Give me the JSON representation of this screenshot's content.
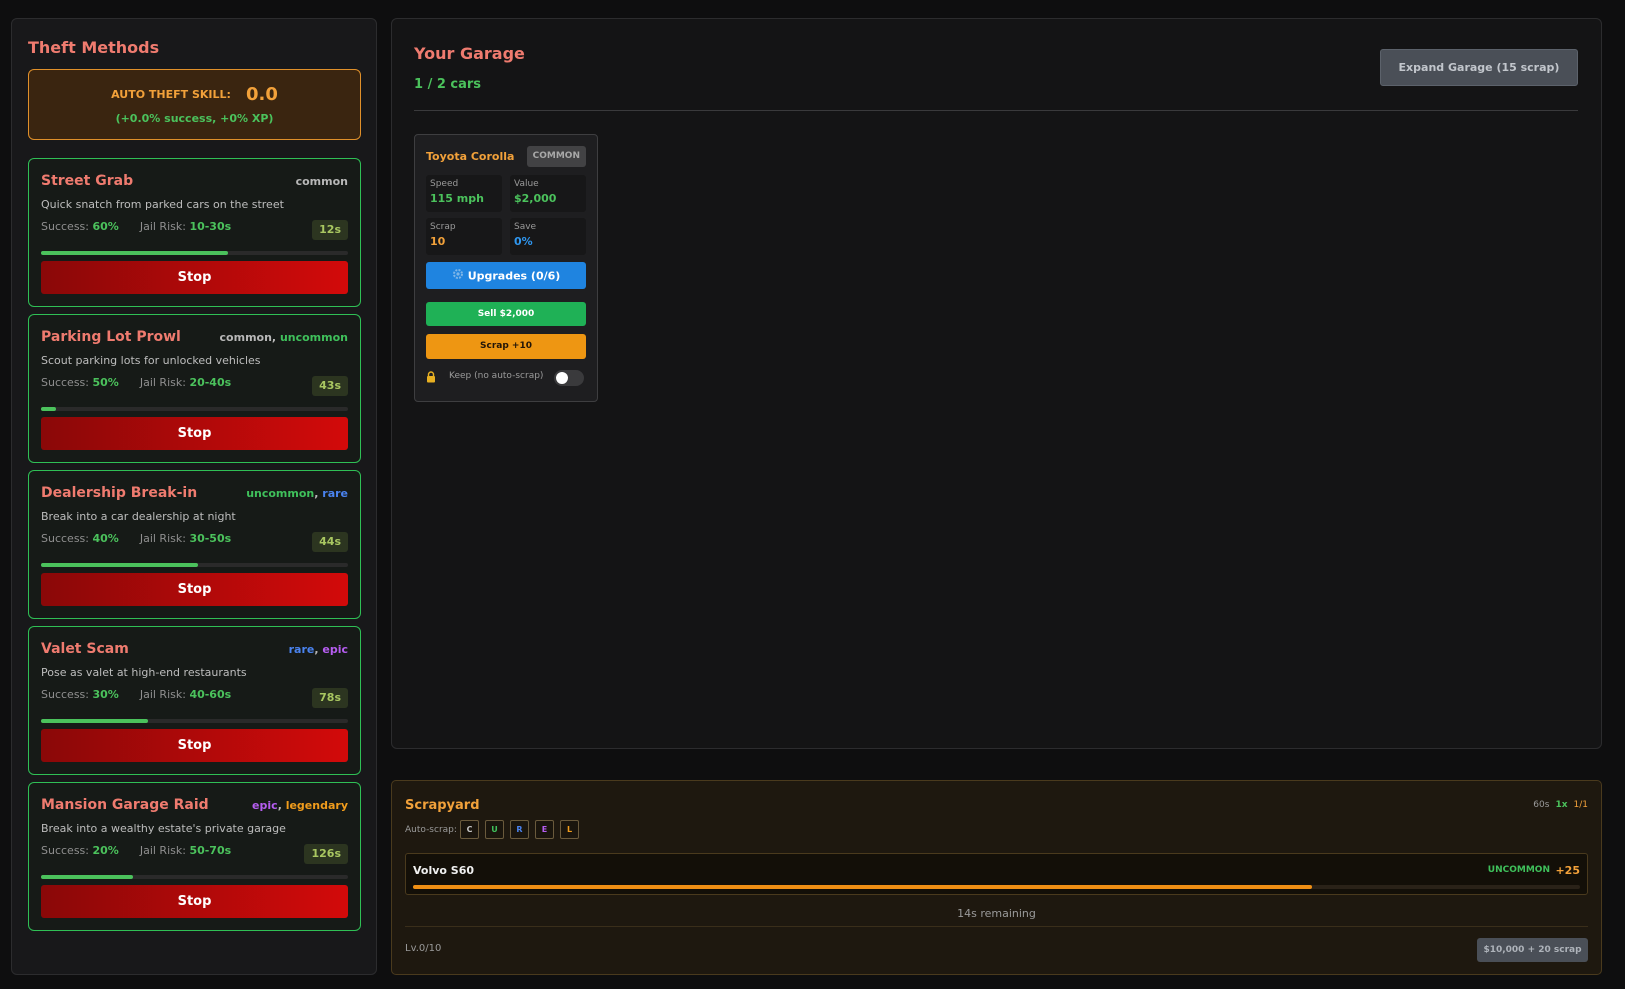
{
  "sidebar": {
    "title": "Theft Methods",
    "skill": {
      "label": "AUTO THEFT SKILL:",
      "value": "0.0",
      "bonus": "(+0.0% success, +0% XP)"
    },
    "success_label": "Success:",
    "jail_label": "Jail Risk:",
    "stop_label": "Stop",
    "methods": [
      {
        "name": "Street Grab",
        "rarities": [
          "common"
        ],
        "desc": "Quick snatch from parked cars on the street",
        "success": "60%",
        "jail": "10-30s",
        "time": "12s",
        "progress": 0.61
      },
      {
        "name": "Parking Lot Prowl",
        "rarities": [
          "common",
          "uncommon"
        ],
        "desc": "Scout parking lots for unlocked vehicles",
        "success": "50%",
        "jail": "20-40s",
        "time": "43s",
        "progress": 0.05
      },
      {
        "name": "Dealership Break-in",
        "rarities": [
          "uncommon",
          "rare"
        ],
        "desc": "Break into a car dealership at night",
        "success": "40%",
        "jail": "30-50s",
        "time": "44s",
        "progress": 0.51
      },
      {
        "name": "Valet Scam",
        "rarities": [
          "rare",
          "epic"
        ],
        "desc": "Pose as valet at high-end restaurants",
        "success": "30%",
        "jail": "40-60s",
        "time": "78s",
        "progress": 0.35
      },
      {
        "name": "Mansion Garage Raid",
        "rarities": [
          "epic",
          "legendary"
        ],
        "desc": "Break into a wealthy estate's private garage",
        "success": "20%",
        "jail": "50-70s",
        "time": "126s",
        "progress": 0.3
      }
    ]
  },
  "garage": {
    "title": "Your Garage",
    "count": "1 / 2 cars",
    "expand_label": "Expand Garage (15 scrap)",
    "car": {
      "name": "Toyota Corolla",
      "badge": "COMMON",
      "speed_label": "Speed",
      "speed": "115 mph",
      "value_label": "Value",
      "value": "$2,000",
      "scrap_label": "Scrap",
      "scrap": "10",
      "save_label": "Save",
      "save": "0%",
      "upgrades_label": "Upgrades (0/6)",
      "upgrades_icon": "gear-icon",
      "sell_label": "Sell $2,000",
      "scrap_btn_label": "Scrap +10",
      "keep_label": "Keep (no auto-scrap)",
      "keep_icon": "lock-icon",
      "keep_enabled": false
    }
  },
  "scrapyard": {
    "title": "Scrapyard",
    "time": "60s",
    "speed": "1x",
    "slots": "1/1",
    "auto_scrap_label": "Auto-scrap:",
    "auto_scrap_options": [
      "C",
      "U",
      "R",
      "E",
      "L"
    ],
    "job": {
      "car": "Volvo S60",
      "rarity": "UNCOMMON",
      "reward": "+25",
      "progress": 0.77
    },
    "remaining": "14s remaining",
    "level": "Lv.0/10",
    "upgrade_label": "$10,000 + 20 scrap"
  },
  "colors": {
    "common": "#b8b8b8",
    "uncommon": "#3fc05b",
    "rare": "#4a83ef",
    "epic": "#b55df0",
    "legendary": "#f09c1c",
    "accent_title": "#ef7b6f",
    "stop": "#d30a0a"
  }
}
